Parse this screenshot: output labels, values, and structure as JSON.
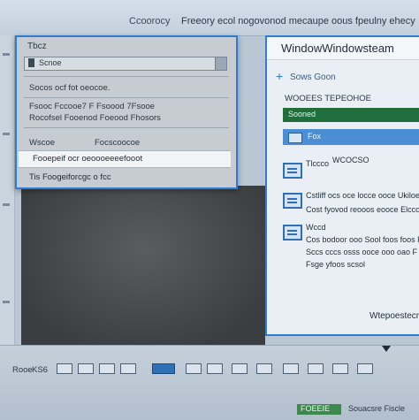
{
  "window": {
    "title_left": "Ccoorocy",
    "title_right": "Freeory ecol nogovonod mecaupe oous fpeulny ehecy"
  },
  "dialog": {
    "title": "Tbcz",
    "field_value": "Scnoe",
    "line_1": "Socos ocf fot oeocoe.",
    "line_2": "Fsooc  Fccooe7  F  Fsoood  7Fsooe",
    "line_3": "Rocofsel  Fooenod  Foeood  Fhosors",
    "line_4_left": "Wscoe",
    "line_4_right": "Focscoocoe",
    "selected_row": "Fooepeif ocr oeoooeeeefooot",
    "last_row": "Tis  Foogeiforcgc  o fcc"
  },
  "panel": {
    "title": "WindowWindowsteam",
    "new_label": "Sows Goon",
    "section_header": "WOOEES TEPEOHOE",
    "green_item": "Sooned",
    "selected_item": "Fox",
    "item1_a": "Tlccco",
    "item1_b": "WCOCSO",
    "item2_line1": "Cstliff  ocs oce  locce ooce Ukiloe",
    "item2_line2": "Cost fyovod  reooos  eooce  Elccoe",
    "item3_label": "Wccd",
    "item3_line1": "Cos bodoor  ooo  Sool  foos foos  F",
    "item3_line2": "Sccs cccs  osss  ooce  ooo oao  F",
    "item3_line3": "Fsge yfoos  scsol",
    "bottom_label": "Wtepoestecre"
  },
  "taskbar": {
    "label_left": "Rooe",
    "label_a": "KS6",
    "status_right": "Souacsre  Fiscle",
    "green_chip": "FOEEIE"
  },
  "colors": {
    "accent_blue": "#2e7dd1",
    "green": "#1f6e3b",
    "dark_area": "#45484b"
  }
}
